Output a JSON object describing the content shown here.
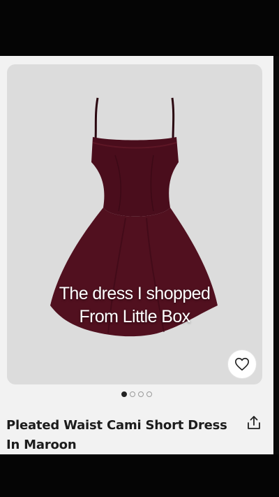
{
  "product": {
    "image_caption_line1": "The dress I shopped",
    "image_caption_line2": "From Little Box",
    "title": "Pleated Waist Cami Short Dress In Maroon",
    "dress_color": "#4a0d1c"
  },
  "carousel": {
    "total": 4,
    "active_index": 0
  },
  "icons": {
    "wishlist": "heart-icon",
    "share": "share-icon"
  }
}
